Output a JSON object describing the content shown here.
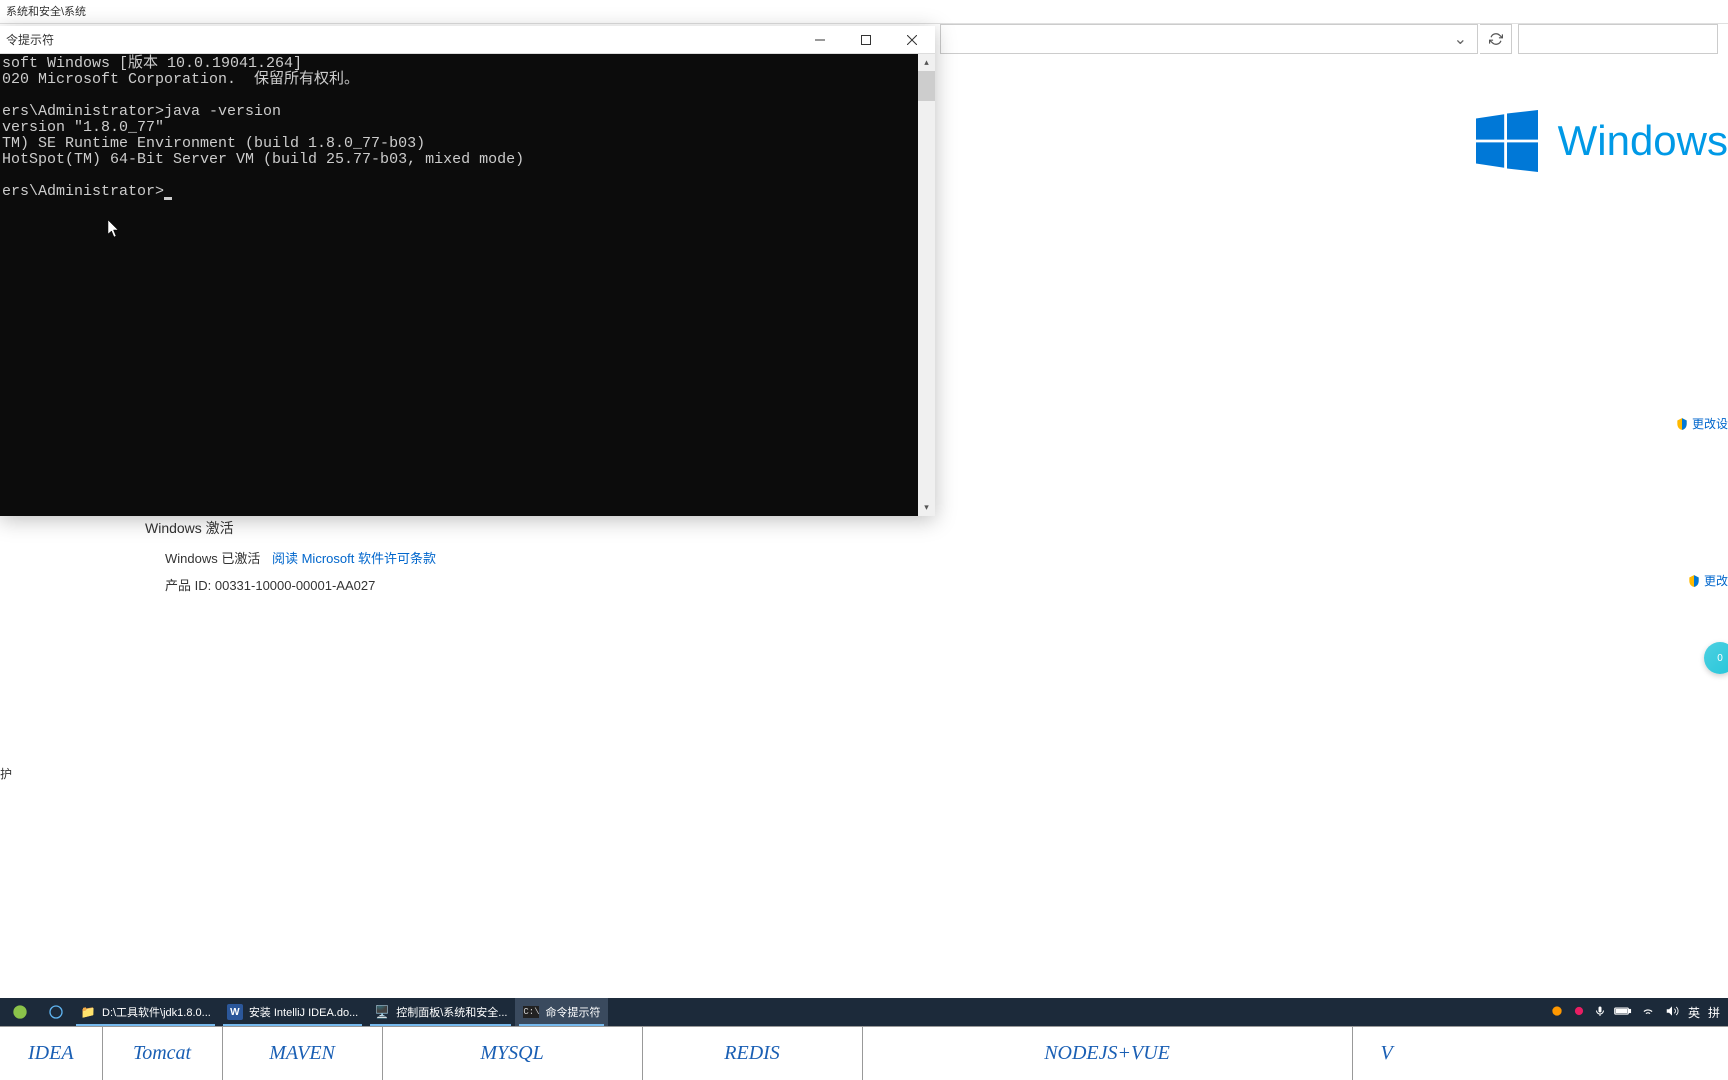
{
  "bg": {
    "titlebar_path": "系统和安全\\系统",
    "protection_label": "护"
  },
  "windows_brand": "Windows",
  "change_settings_link": "更改设",
  "change_settings_link2": "更改",
  "activation": {
    "heading": "Windows 激活",
    "status": "Windows 已激活",
    "license_link": "阅读 Microsoft 软件许可条款",
    "product_id_label": "产品 ID:",
    "product_id_value": "00331-10000-00001-AA027"
  },
  "cmd": {
    "title": "令提示符",
    "lines": [
      "soft Windows [版本 10.0.19041.264]",
      "020 Microsoft Corporation.  保留所有权利。",
      "",
      "ers\\Administrator>java -version",
      "version \"1.8.0_77\"",
      "TM) SE Runtime Environment (build 1.8.0_77-b03)",
      "HotSpot(TM) 64-Bit Server VM (build 25.77-b03, mixed mode)",
      "",
      "ers\\Administrator>"
    ]
  },
  "taskbar": {
    "items": [
      {
        "label": "D:\\工具软件\\jdk1.8.0...",
        "icon": "📁",
        "color": "#ffd966"
      },
      {
        "label": "安装 IntelliJ IDEA.do...",
        "icon": "W",
        "color": "#2b579a"
      },
      {
        "label": "控制面板\\系统和安全...",
        "icon": "🖥",
        "color": "#6eb5ff"
      },
      {
        "label": "命令提示符",
        "icon": "▮",
        "color": "#333"
      }
    ],
    "ime_lang": "英",
    "ime_mode": "拼"
  },
  "bottom_tabs": [
    "IDEA",
    "Tomcat",
    "MAVEN",
    "MYSQL",
    "REDIS",
    "NODEJS+VUE",
    "V"
  ],
  "float_badge": "0"
}
